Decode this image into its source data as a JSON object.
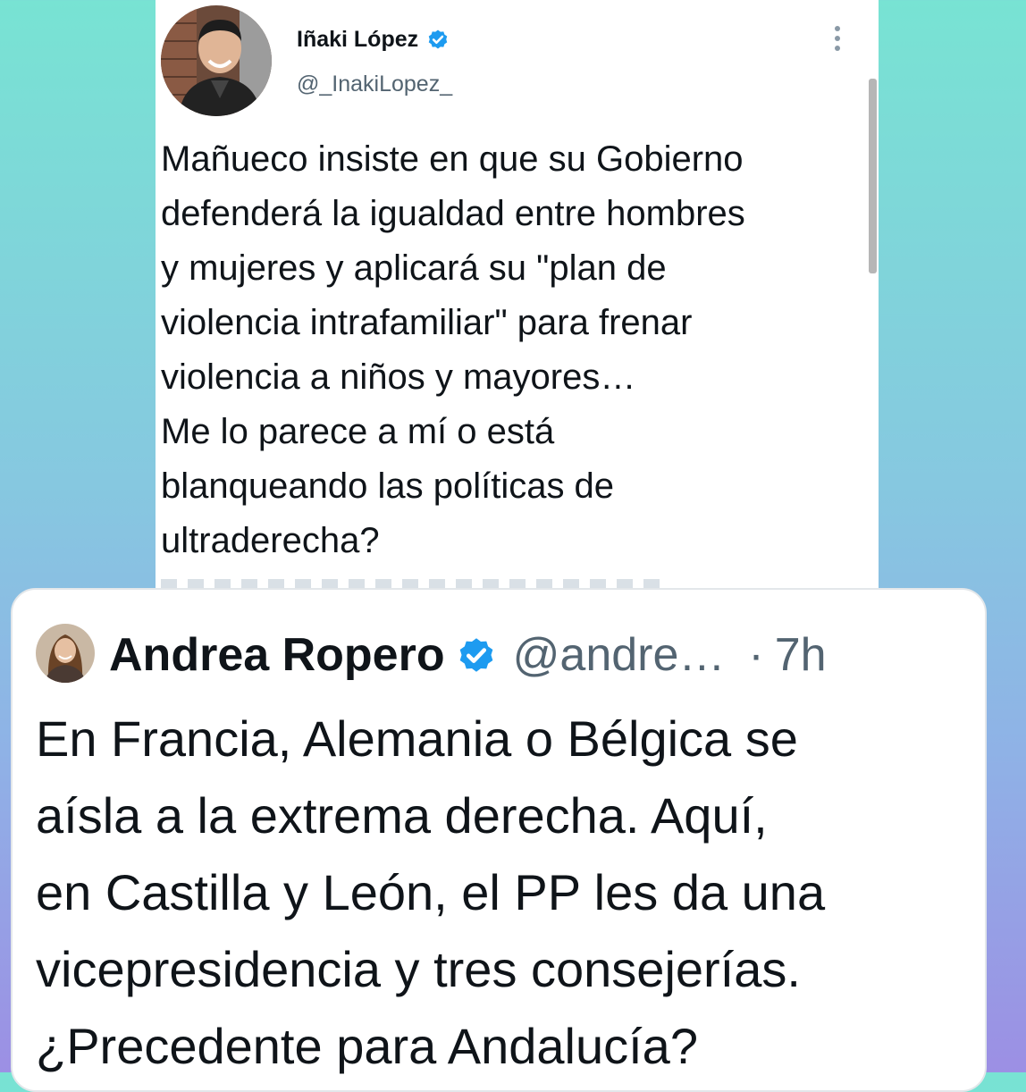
{
  "tweet_top": {
    "author_name": "Iñaki López",
    "handle": "@_InakiLopez_",
    "text": "Mañueco insiste en que su Gobierno\ndefenderá la igualdad entre hombres\ny mujeres y aplicará su \"plan de\nviolencia intrafamiliar\" para frenar\nviolencia a niños y mayores…\nMe lo parece a mí o está\nblanqueando las políticas de\nultraderecha?",
    "icons": {
      "verified": "verified-badge-icon",
      "menu": "more-vertical-icon"
    }
  },
  "tweet_bottom": {
    "author_name": "Andrea Ropero",
    "handle": "@andre…",
    "separator": "·",
    "time": "7h",
    "text": "En Francia, Alemania o Bélgica se\naísla a la extrema derecha. Aquí,\nen Castilla y León, el PP les da una\nvicepresidencia y tres consejerías.\n¿Precedente para Andalucía?",
    "icons": {
      "verified": "verified-badge-icon"
    }
  },
  "colors": {
    "verified_blue": "#1d9bf0",
    "text_primary": "#0f1419",
    "text_secondary": "#536471"
  }
}
